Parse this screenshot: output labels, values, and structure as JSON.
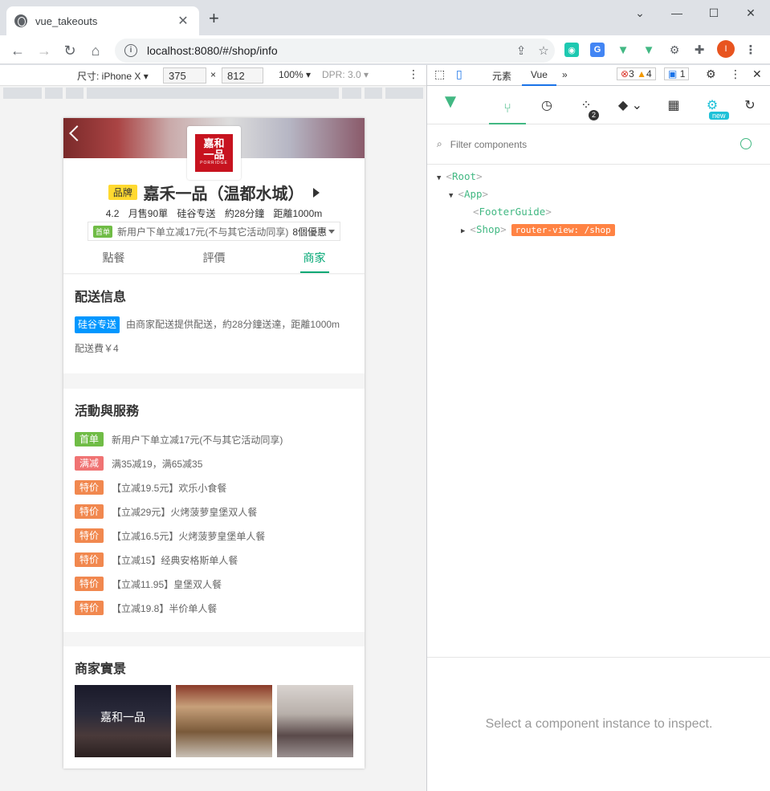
{
  "browser": {
    "tab_title": "vue_takeouts",
    "url": "localhost:8080/#/shop/info",
    "avatar_letter": "I"
  },
  "device_toolbar": {
    "device": "尺寸: iPhone X",
    "width": "375",
    "height": "812",
    "zoom": "100%",
    "dpr": "DPR: 3.0"
  },
  "shop": {
    "brand_tag": "品牌",
    "name": "嘉禾一品（温都水城）",
    "logo_text_1": "嘉和",
    "logo_text_2": "一品",
    "logo_sub": "PORRIDGE",
    "rating": "4.2",
    "monthly_sales": "月售90單",
    "delivery_brand": "硅谷专送",
    "delivery_time": "約28分鐘",
    "distance": "距離1000m",
    "promo_tag": "首单",
    "promo_text": "新用户下单立减17元(不与其它活动同享)",
    "promo_count": "8個優惠"
  },
  "tabs": [
    "點餐",
    "評價",
    "商家"
  ],
  "delivery_info": {
    "title": "配送信息",
    "label": "硅谷专送",
    "desc": "由商家配送提供配送，約28分鐘送達，距離1000m",
    "fee": "配送費￥4"
  },
  "activities": {
    "title": "活動與服務",
    "items": [
      {
        "badge": "首单",
        "color": "#70bc46",
        "text": "新用户下单立减17元(不与其它活动同享)"
      },
      {
        "badge": "满减",
        "color": "#f07373",
        "text": "满35减19，满65减35"
      },
      {
        "badge": "特价",
        "color": "#f1884f",
        "text": "【立减19.5元】欢乐小食餐"
      },
      {
        "badge": "特价",
        "color": "#f1884f",
        "text": "【立减29元】火烤菠萝皇堡双人餐"
      },
      {
        "badge": "特价",
        "color": "#f1884f",
        "text": "【立减16.5元】火烤菠萝皇堡单人餐"
      },
      {
        "badge": "特价",
        "color": "#f1884f",
        "text": "【立减15】经典安格斯单人餐"
      },
      {
        "badge": "特价",
        "color": "#f1884f",
        "text": "【立减11.95】皇堡双人餐"
      },
      {
        "badge": "特价",
        "color": "#f1884f",
        "text": "【立减19.8】半价单人餐"
      }
    ]
  },
  "photos": {
    "title": "商家實景",
    "items": [
      "storefront-photo",
      "counter-photo",
      "dining-room-photo"
    ]
  },
  "devtools": {
    "tab_elements": "元素",
    "tab_vue": "Vue",
    "errors": "3",
    "warnings": "4",
    "messages": "1",
    "timeline_badge": "2",
    "settings_badge": "new",
    "filter_placeholder": "Filter components",
    "tree": {
      "root": "Root",
      "app": "App",
      "footer": "FooterGuide",
      "shop": "Shop",
      "router_view": "router-view: /shop"
    },
    "inspect_hint": "Select a component instance to inspect."
  },
  "colors": {
    "vue_green": "#42b883",
    "takeout_green": "#02a774",
    "delivery_blue": "#0097ff",
    "router_orange": "#ff8344"
  }
}
